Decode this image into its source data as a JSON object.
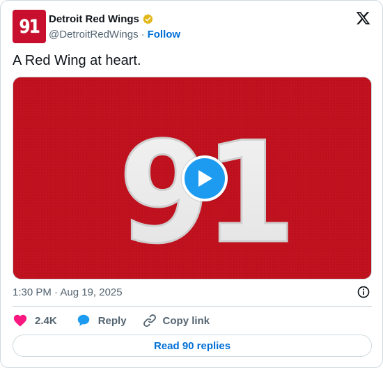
{
  "author": {
    "avatar_text": "91",
    "display_name": "Detroit Red Wings",
    "handle": "@DetroitRedWings",
    "separator": "·",
    "follow_label": "Follow"
  },
  "tweet": {
    "text": "A Red Wing at heart.",
    "timestamp": "1:30 PM · Aug 19, 2025"
  },
  "media": {
    "jersey_number": "91"
  },
  "actions": {
    "like_count": "2.4K",
    "reply_label": "Reply",
    "copy_link_label": "Copy link"
  },
  "read_replies_label": "Read 90 replies",
  "colors": {
    "red": "#c8102e",
    "blue": "#1d9bf0",
    "link": "#006fd6",
    "like": "#f91880",
    "verified_gold": "#e2b719"
  },
  "icons": [
    "verified-badge-icon",
    "x-logo-icon",
    "play-icon",
    "info-icon",
    "heart-icon",
    "reply-bubble-icon",
    "link-icon"
  ]
}
